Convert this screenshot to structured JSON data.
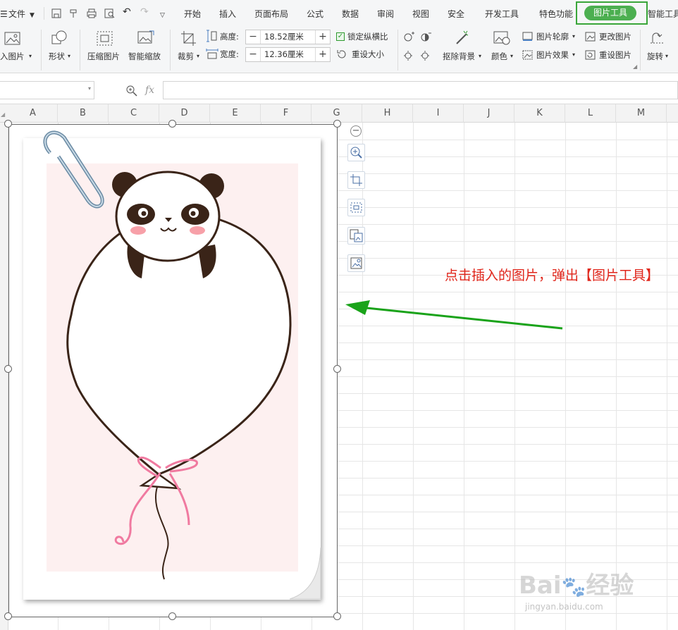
{
  "menubar": {
    "file": "文件",
    "tabs": [
      "开始",
      "插入",
      "页面布局",
      "公式",
      "数据",
      "审阅",
      "视图",
      "安全",
      "开发工具",
      "特色功能",
      "图片工具",
      "智能工具"
    ],
    "active_tab": "图片工具"
  },
  "ribbon": {
    "insert_picture": "入图片",
    "shape": "形状",
    "compress": "压缩图片",
    "smart_zoom": "智能缩放",
    "crop": "裁剪",
    "height_label": "高度:",
    "height_value": "18.52厘米",
    "width_label": "宽度:",
    "width_value": "12.36厘米",
    "lock_ratio": "锁定纵横比",
    "reset_size": "重设大小",
    "remove_bg": "抠除背景",
    "color": "颜色",
    "outline": "图片轮廓",
    "effects": "图片效果",
    "change_picture": "更改图片",
    "reset_picture": "重设图片",
    "rotate": "旋转",
    "minus": "−",
    "plus": "+"
  },
  "formula_bar": {
    "fx": "fx",
    "value": ""
  },
  "columns": [
    "A",
    "B",
    "C",
    "D",
    "E",
    "F",
    "G",
    "H",
    "I",
    "J",
    "K",
    "L",
    "M"
  ],
  "annotation": "点击插入的图片，弹出【图片工具】",
  "watermark": {
    "brand": "Bai",
    "brand2": "经验",
    "url": "jingyan.baidu.com"
  },
  "colors": {
    "accent_green": "#4caf50",
    "annotation_red": "#e0261b",
    "arrow_green": "#1aa31a"
  }
}
